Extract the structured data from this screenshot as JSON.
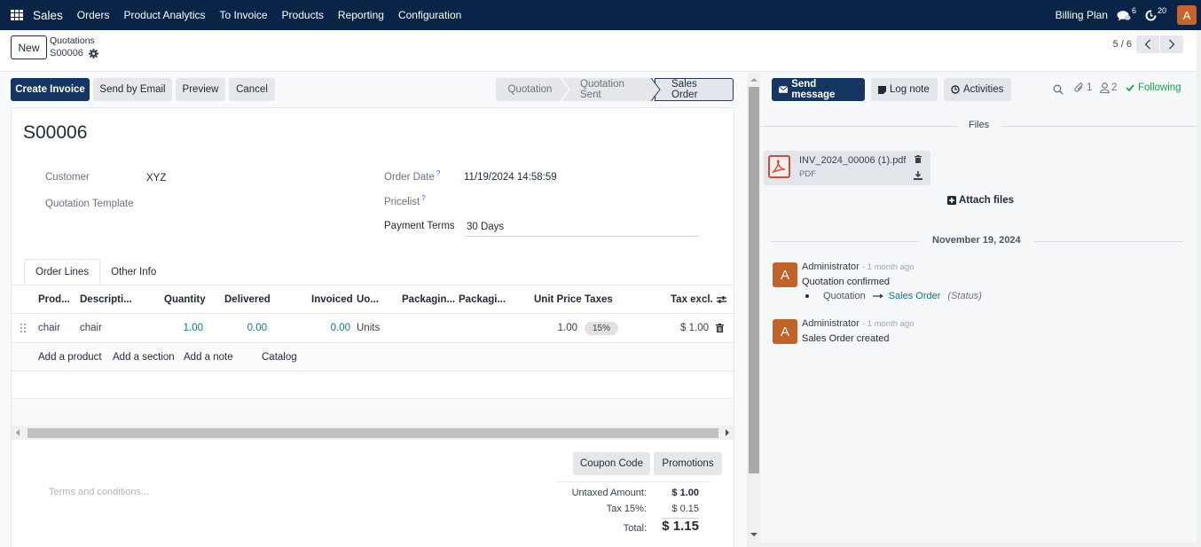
{
  "navbar": {
    "app_name": "Sales",
    "menu": [
      "Orders",
      "Product Analytics",
      "To Invoice",
      "Products",
      "Reporting",
      "Configuration"
    ],
    "company": "Billing Plan",
    "messages_count": "6",
    "activities_count": "20",
    "user_initial": "A",
    "colors": {
      "navbar_bg": "#0a2447",
      "avatar_bg": "#c8642a"
    }
  },
  "control_panel": {
    "new_label": "New",
    "breadcrumb_parent": "Quotations",
    "breadcrumb_current": "S00006",
    "pager": "5 / 6"
  },
  "actions": {
    "create_invoice": "Create Invoice",
    "send_by_email": "Send by Email",
    "preview": "Preview",
    "cancel": "Cancel"
  },
  "status": {
    "steps": [
      "Quotation",
      "Quotation Sent",
      "Sales Order"
    ],
    "current": "Sales Order"
  },
  "form": {
    "title": "S00006",
    "customer_label": "Customer",
    "customer_value": "XYZ",
    "quotation_template_label": "Quotation Template",
    "quotation_template_value": "",
    "order_date_label": "Order Date",
    "order_date_value": "11/19/2024 14:58:59",
    "pricelist_label": "Pricelist",
    "pricelist_value": "",
    "payment_terms_label": "Payment Terms",
    "payment_terms_value": "30 Days",
    "help_mark": "?"
  },
  "tabs": [
    "Order Lines",
    "Other Info"
  ],
  "order_lines": {
    "columns": [
      "Prod...",
      "Descripti...",
      "Quantity",
      "Delivered",
      "Invoiced",
      "Uo...",
      "Packagin...",
      "Packagi...",
      "Unit Price",
      "Taxes",
      "Tax excl."
    ],
    "rows": [
      {
        "product": "chair",
        "description": "chair",
        "quantity": "1.00",
        "delivered": "0.00",
        "invoiced": "0.00",
        "uom": "Units",
        "packaging_qty": "",
        "packaging": "",
        "unit_price": "1.00",
        "taxes": "15%",
        "subtotal": "$ 1.00"
      }
    ],
    "add_links": [
      "Add a product",
      "Add a section",
      "Add a note",
      "Catalog"
    ]
  },
  "footer": {
    "terms_placeholder": "Terms and conditions...",
    "coupon_code": "Coupon Code",
    "promotions": "Promotions",
    "untaxed_label": "Untaxed Amount:",
    "untaxed_value": "$ 1.00",
    "tax_label": "Tax 15%:",
    "tax_value": "$ 0.15",
    "total_label": "Total:",
    "total_value": "$ 1.15"
  },
  "chatter": {
    "send_message": "Send message",
    "log_note": "Log note",
    "activities": "Activities",
    "attachments_count": "1",
    "followers_count": "2",
    "following_label": "Following",
    "files_title": "Files",
    "file": {
      "name": "INV_2024_00006 (1).pdf",
      "type": "PDF"
    },
    "attach_files": "Attach files",
    "date_separator": "November 19, 2024",
    "messages": [
      {
        "avatar": "A",
        "author": "Administrator",
        "ago": "- 1 month ago",
        "body": "Quotation confirmed",
        "tracking": {
          "old": "Quotation",
          "new": "Sales Order",
          "field": "(Status)"
        }
      },
      {
        "avatar": "A",
        "author": "Administrator",
        "ago": "- 1 month ago",
        "body": "Sales Order created"
      }
    ],
    "colors": {
      "following": "#16a34a",
      "link": "#0e7490"
    }
  }
}
